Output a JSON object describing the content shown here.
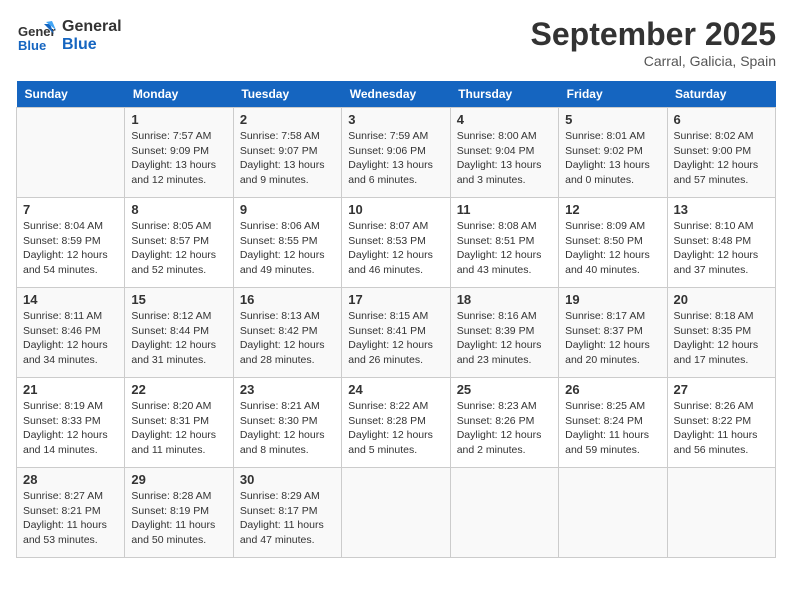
{
  "header": {
    "logo_line1": "General",
    "logo_line2": "Blue",
    "month": "September 2025",
    "location": "Carral, Galicia, Spain"
  },
  "weekdays": [
    "Sunday",
    "Monday",
    "Tuesday",
    "Wednesday",
    "Thursday",
    "Friday",
    "Saturday"
  ],
  "weeks": [
    [
      {
        "day": "",
        "text": ""
      },
      {
        "day": "1",
        "text": "Sunrise: 7:57 AM\nSunset: 9:09 PM\nDaylight: 13 hours\nand 12 minutes."
      },
      {
        "day": "2",
        "text": "Sunrise: 7:58 AM\nSunset: 9:07 PM\nDaylight: 13 hours\nand 9 minutes."
      },
      {
        "day": "3",
        "text": "Sunrise: 7:59 AM\nSunset: 9:06 PM\nDaylight: 13 hours\nand 6 minutes."
      },
      {
        "day": "4",
        "text": "Sunrise: 8:00 AM\nSunset: 9:04 PM\nDaylight: 13 hours\nand 3 minutes."
      },
      {
        "day": "5",
        "text": "Sunrise: 8:01 AM\nSunset: 9:02 PM\nDaylight: 13 hours\nand 0 minutes."
      },
      {
        "day": "6",
        "text": "Sunrise: 8:02 AM\nSunset: 9:00 PM\nDaylight: 12 hours\nand 57 minutes."
      }
    ],
    [
      {
        "day": "7",
        "text": "Sunrise: 8:04 AM\nSunset: 8:59 PM\nDaylight: 12 hours\nand 54 minutes."
      },
      {
        "day": "8",
        "text": "Sunrise: 8:05 AM\nSunset: 8:57 PM\nDaylight: 12 hours\nand 52 minutes."
      },
      {
        "day": "9",
        "text": "Sunrise: 8:06 AM\nSunset: 8:55 PM\nDaylight: 12 hours\nand 49 minutes."
      },
      {
        "day": "10",
        "text": "Sunrise: 8:07 AM\nSunset: 8:53 PM\nDaylight: 12 hours\nand 46 minutes."
      },
      {
        "day": "11",
        "text": "Sunrise: 8:08 AM\nSunset: 8:51 PM\nDaylight: 12 hours\nand 43 minutes."
      },
      {
        "day": "12",
        "text": "Sunrise: 8:09 AM\nSunset: 8:50 PM\nDaylight: 12 hours\nand 40 minutes."
      },
      {
        "day": "13",
        "text": "Sunrise: 8:10 AM\nSunset: 8:48 PM\nDaylight: 12 hours\nand 37 minutes."
      }
    ],
    [
      {
        "day": "14",
        "text": "Sunrise: 8:11 AM\nSunset: 8:46 PM\nDaylight: 12 hours\nand 34 minutes."
      },
      {
        "day": "15",
        "text": "Sunrise: 8:12 AM\nSunset: 8:44 PM\nDaylight: 12 hours\nand 31 minutes."
      },
      {
        "day": "16",
        "text": "Sunrise: 8:13 AM\nSunset: 8:42 PM\nDaylight: 12 hours\nand 28 minutes."
      },
      {
        "day": "17",
        "text": "Sunrise: 8:15 AM\nSunset: 8:41 PM\nDaylight: 12 hours\nand 26 minutes."
      },
      {
        "day": "18",
        "text": "Sunrise: 8:16 AM\nSunset: 8:39 PM\nDaylight: 12 hours\nand 23 minutes."
      },
      {
        "day": "19",
        "text": "Sunrise: 8:17 AM\nSunset: 8:37 PM\nDaylight: 12 hours\nand 20 minutes."
      },
      {
        "day": "20",
        "text": "Sunrise: 8:18 AM\nSunset: 8:35 PM\nDaylight: 12 hours\nand 17 minutes."
      }
    ],
    [
      {
        "day": "21",
        "text": "Sunrise: 8:19 AM\nSunset: 8:33 PM\nDaylight: 12 hours\nand 14 minutes."
      },
      {
        "day": "22",
        "text": "Sunrise: 8:20 AM\nSunset: 8:31 PM\nDaylight: 12 hours\nand 11 minutes."
      },
      {
        "day": "23",
        "text": "Sunrise: 8:21 AM\nSunset: 8:30 PM\nDaylight: 12 hours\nand 8 minutes."
      },
      {
        "day": "24",
        "text": "Sunrise: 8:22 AM\nSunset: 8:28 PM\nDaylight: 12 hours\nand 5 minutes."
      },
      {
        "day": "25",
        "text": "Sunrise: 8:23 AM\nSunset: 8:26 PM\nDaylight: 12 hours\nand 2 minutes."
      },
      {
        "day": "26",
        "text": "Sunrise: 8:25 AM\nSunset: 8:24 PM\nDaylight: 11 hours\nand 59 minutes."
      },
      {
        "day": "27",
        "text": "Sunrise: 8:26 AM\nSunset: 8:22 PM\nDaylight: 11 hours\nand 56 minutes."
      }
    ],
    [
      {
        "day": "28",
        "text": "Sunrise: 8:27 AM\nSunset: 8:21 PM\nDaylight: 11 hours\nand 53 minutes."
      },
      {
        "day": "29",
        "text": "Sunrise: 8:28 AM\nSunset: 8:19 PM\nDaylight: 11 hours\nand 50 minutes."
      },
      {
        "day": "30",
        "text": "Sunrise: 8:29 AM\nSunset: 8:17 PM\nDaylight: 11 hours\nand 47 minutes."
      },
      {
        "day": "",
        "text": ""
      },
      {
        "day": "",
        "text": ""
      },
      {
        "day": "",
        "text": ""
      },
      {
        "day": "",
        "text": ""
      }
    ]
  ]
}
